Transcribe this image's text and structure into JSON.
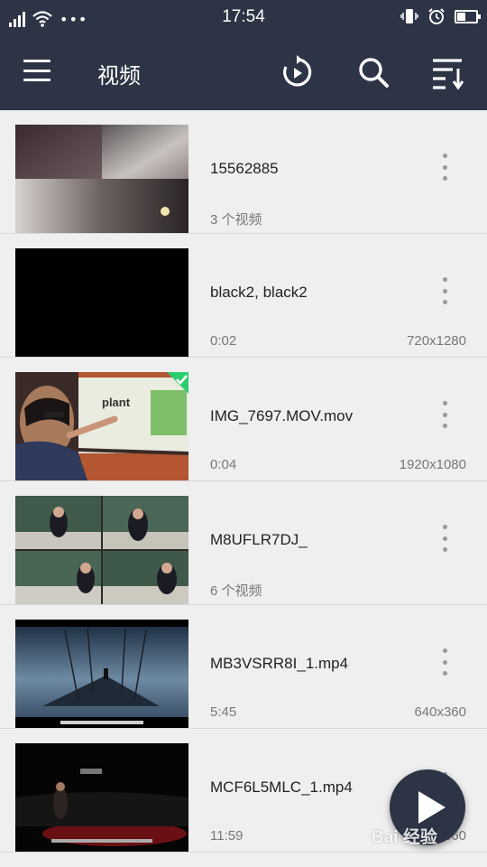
{
  "status_bar": {
    "time": "17:54",
    "dots": "•••"
  },
  "app_bar": {
    "title": "视频"
  },
  "items": [
    {
      "title": "15562885",
      "subtitle": "3 个视频",
      "resolution": ""
    },
    {
      "title": "black2, black2",
      "subtitle": "0:02",
      "resolution": "720x1280"
    },
    {
      "title": "IMG_7697.MOV.mov",
      "subtitle": "0:04",
      "resolution": "1920x1080"
    },
    {
      "title": "M8UFLR7DJ_",
      "subtitle": "6 个视频",
      "resolution": ""
    },
    {
      "title": "MB3VSRR8I_1.mp4",
      "subtitle": "5:45",
      "resolution": "640x360"
    },
    {
      "title": "MCF6L5MLC_1.mp4",
      "subtitle": "11:59",
      "resolution": "640x360"
    }
  ],
  "thumb3_text": "plant",
  "watermark": "Bai 经验",
  "colors": {
    "app_bar": "#2c3445",
    "background": "#efefef",
    "check_badge": "#2ecc71"
  }
}
